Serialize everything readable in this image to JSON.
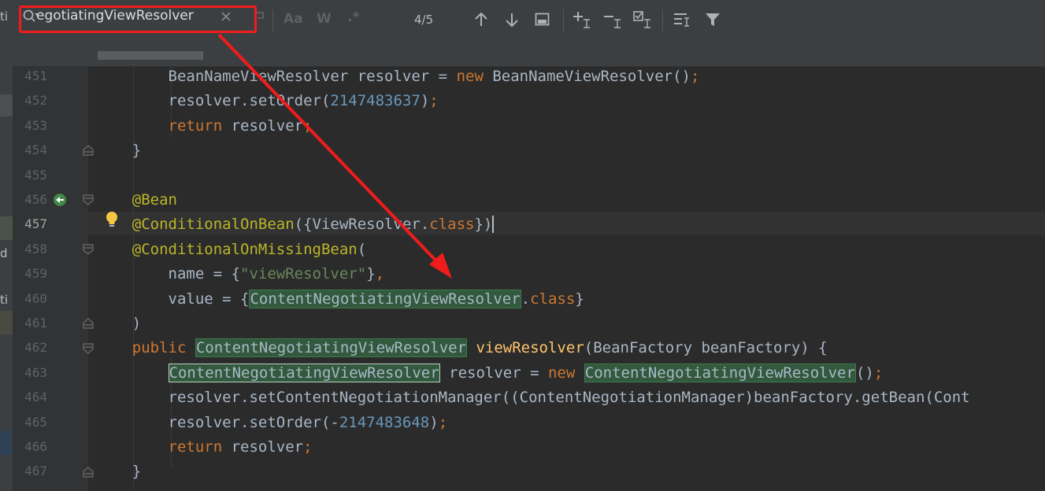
{
  "left_fragments": [
    "ti",
    "d",
    "ti"
  ],
  "search": {
    "query": "egotiatingViewResolver",
    "match_count": "4/5",
    "toggle_case": "Aa",
    "toggle_words": "W",
    "toggle_regex": ".*"
  },
  "colors": {
    "annotation_border": "#f01c1c",
    "match_highlight": "#32593d",
    "keyword": "#cc7832",
    "annotation": "#bbb529"
  },
  "editor": {
    "current_line": "457",
    "lines": [
      {
        "n": "451",
        "parts": [
          {
            "t": "        BeanNameViewResolver resolver = "
          },
          {
            "t": "new",
            "c": "kw"
          },
          {
            "t": " BeanNameViewResolver()"
          },
          {
            "t": ";",
            "c": "kw"
          }
        ]
      },
      {
        "n": "452",
        "parts": [
          {
            "t": "        resolver.setOrder("
          },
          {
            "t": "2147483637",
            "c": "nm"
          },
          {
            "t": ")"
          },
          {
            "t": ";",
            "c": "kw"
          }
        ]
      },
      {
        "n": "453",
        "parts": [
          {
            "t": "        "
          },
          {
            "t": "return",
            "c": "kw"
          },
          {
            "t": " resolver"
          },
          {
            "t": ";",
            "c": "kw"
          }
        ]
      },
      {
        "n": "454",
        "parts": [
          {
            "t": "    }"
          }
        ]
      },
      {
        "n": "455",
        "parts": [
          {
            "t": ""
          }
        ]
      },
      {
        "n": "456",
        "parts": [
          {
            "t": "    "
          },
          {
            "t": "@Bean",
            "c": "an"
          }
        ]
      },
      {
        "n": "457",
        "parts": [
          {
            "t": "    "
          },
          {
            "t": "@ConditionalOnBean",
            "c": "an"
          },
          {
            "t": "({ViewResolver."
          },
          {
            "t": "class",
            "c": "kw"
          },
          {
            "t": "})"
          }
        ]
      },
      {
        "n": "458",
        "parts": [
          {
            "t": "    "
          },
          {
            "t": "@ConditionalOnMissingBean",
            "c": "an"
          },
          {
            "t": "("
          }
        ]
      },
      {
        "n": "459",
        "parts": [
          {
            "t": "        name = {"
          },
          {
            "t": "\"viewResolver\"",
            "c": "st"
          },
          {
            "t": "}"
          },
          {
            "t": ",",
            "c": "kw"
          }
        ]
      },
      {
        "n": "460",
        "parts": [
          {
            "t": "        value = {"
          },
          {
            "t": "ContentNegotiatingViewResolver",
            "c": "hl"
          },
          {
            "t": "."
          },
          {
            "t": "class",
            "c": "kw"
          },
          {
            "t": "}"
          }
        ]
      },
      {
        "n": "461",
        "parts": [
          {
            "t": "    )"
          }
        ]
      },
      {
        "n": "462",
        "parts": [
          {
            "t": "    "
          },
          {
            "t": "public",
            "c": "kw"
          },
          {
            "t": " "
          },
          {
            "t": "ContentNegotiatingViewResolver",
            "c": "hl"
          },
          {
            "t": " "
          },
          {
            "t": "viewResolver",
            "c": "fn"
          },
          {
            "t": "(BeanFactory beanFactory) {"
          }
        ]
      },
      {
        "n": "463",
        "parts": [
          {
            "t": "        "
          },
          {
            "t": "ContentNegotiatingViewResolver",
            "c": "hlcur"
          },
          {
            "t": " resolver = "
          },
          {
            "t": "new",
            "c": "kw"
          },
          {
            "t": " "
          },
          {
            "t": "ContentNegotiatingViewResolver",
            "c": "hl"
          },
          {
            "t": "()"
          },
          {
            "t": ";",
            "c": "kw"
          }
        ]
      },
      {
        "n": "464",
        "parts": [
          {
            "t": "        resolver.setContentNegotiationManager((ContentNegotiationManager)beanFactory.getBean(Cont"
          }
        ]
      },
      {
        "n": "465",
        "parts": [
          {
            "t": "        resolver.setOrder(-"
          },
          {
            "t": "2147483648",
            "c": "nm"
          },
          {
            "t": ")"
          },
          {
            "t": ";",
            "c": "kw"
          }
        ]
      },
      {
        "n": "466",
        "parts": [
          {
            "t": "        "
          },
          {
            "t": "return",
            "c": "kw"
          },
          {
            "t": " resolver"
          },
          {
            "t": ";",
            "c": "kw"
          }
        ]
      },
      {
        "n": "467",
        "parts": [
          {
            "t": "    }"
          }
        ]
      }
    ]
  }
}
